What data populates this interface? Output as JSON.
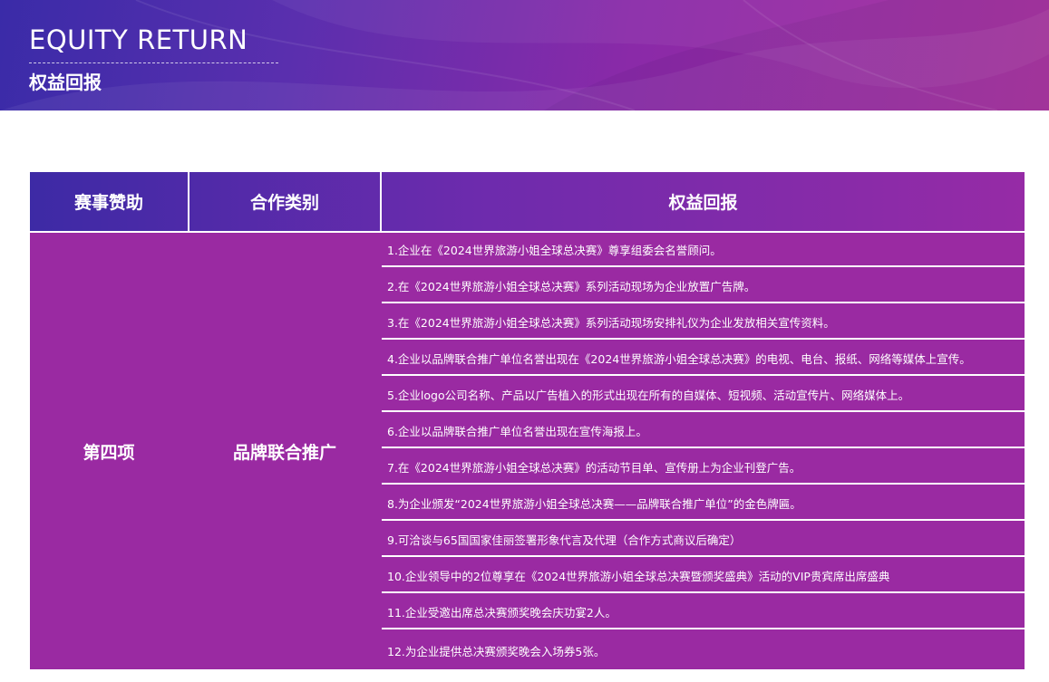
{
  "banner": {
    "title": "EQUITY RETURN",
    "subtitle": "权益回报"
  },
  "colors": {
    "banner_start": "#3a2ba8",
    "banner_end": "#a52b9c",
    "table_fill": "#9a2aa2",
    "text": "#ffffff"
  },
  "table": {
    "headers": [
      "赛事赞助",
      "合作类别",
      "权益回报"
    ],
    "sponsor_level": "第四项",
    "category": "品牌联合推广",
    "items": [
      "1.企业在《2024世界旅游小姐全球总决赛》尊享组委会名誉顾问。",
      "2.在《2024世界旅游小姐全球总决赛》系列活动现场为企业放置广告牌。",
      "3.在《2024世界旅游小姐全球总决赛》系列活动现场安排礼仪为企业发放相关宣传资料。",
      "4.企业以品牌联合推广单位名誉出现在《2024世界旅游小姐全球总决赛》的电视、电台、报纸、网络等媒体上宣传。",
      "5.企业logo公司名称、产品以广告植入的形式出现在所有的自媒体、短视频、活动宣传片、网络媒体上。",
      "6.企业以品牌联合推广单位名誉出现在宣传海报上。",
      "7.在《2024世界旅游小姐全球总决赛》的活动节目单、宣传册上为企业刊登广告。",
      "8.为企业颁发“2024世界旅游小姐全球总决赛——品牌联合推广单位”的金色牌匾。",
      "9.可洽谈与65国国家佳丽签署形象代言及代理（合作方式商议后确定）",
      "10.企业领导中的2位尊享在《2024世界旅游小姐全球总决赛暨颁奖盛典》活动的VIP贵宾席出席盛典",
      "11.企业受邀出席总决赛颁奖晚会庆功宴2人。",
      "12.为企业提供总决赛颁奖晚会入场券5张。"
    ]
  }
}
